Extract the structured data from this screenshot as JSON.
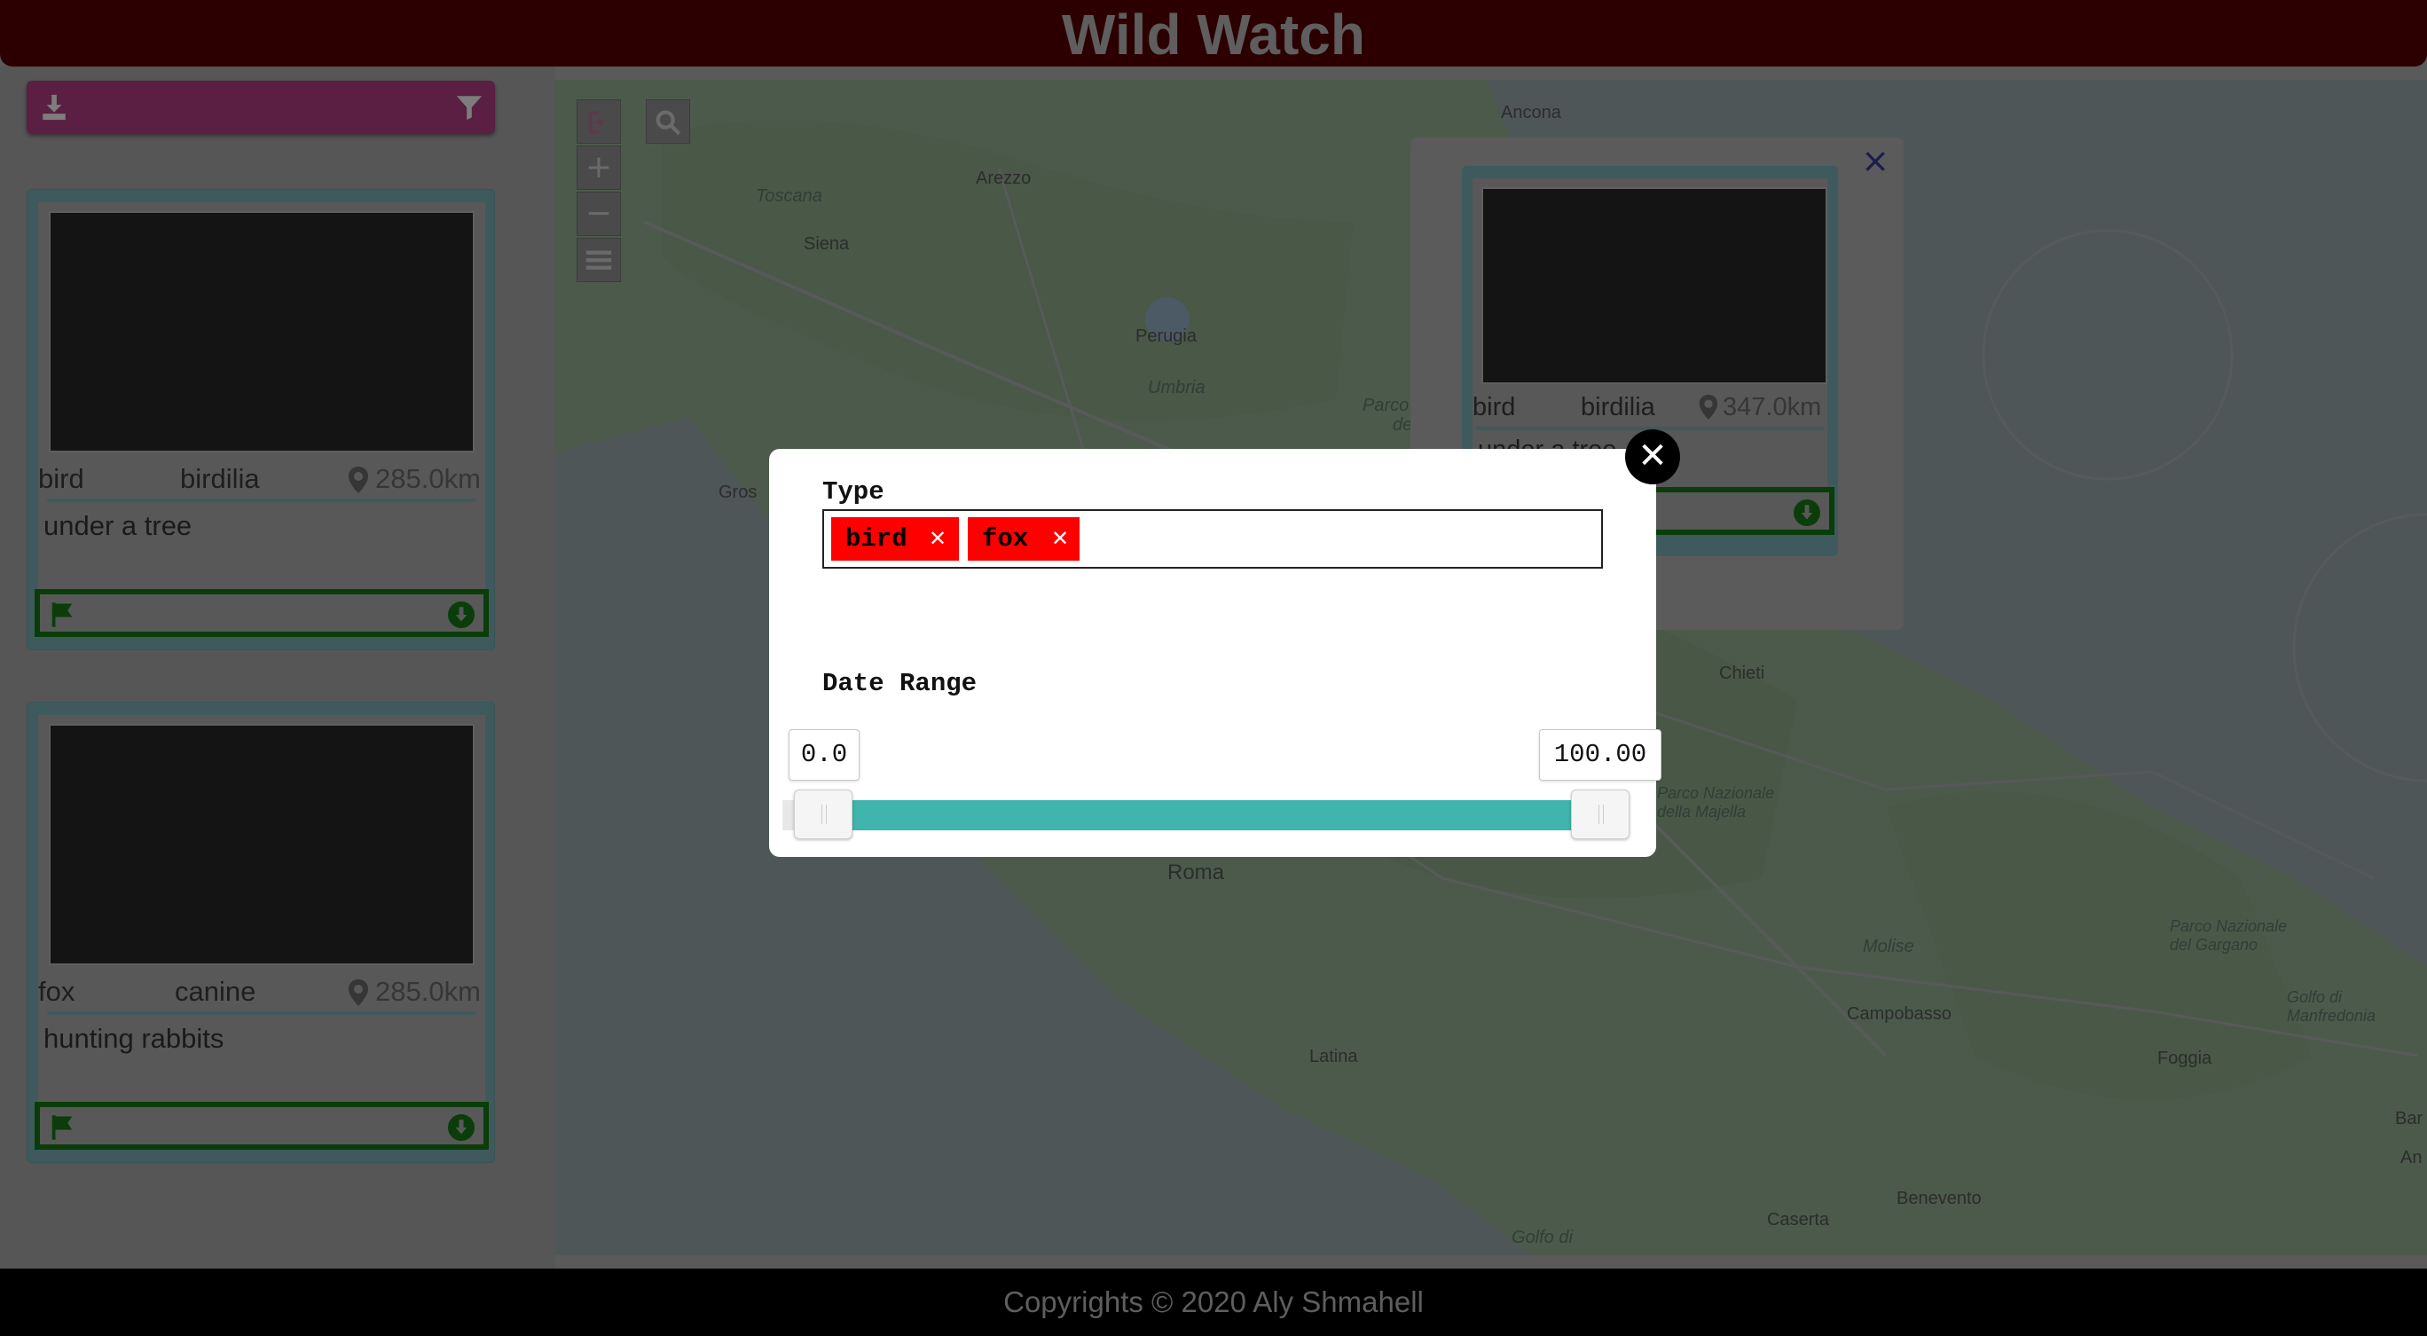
{
  "app": {
    "title": "Wild Watch"
  },
  "toolbar": {
    "download_icon": "download-icon",
    "filter_icon": "filter-icon"
  },
  "cards": [
    {
      "type": "bird",
      "family": "birdilia",
      "distance": "285.0km",
      "description": "under a tree"
    },
    {
      "type": "fox",
      "family": "canine",
      "distance": "285.0km",
      "description": "hunting rabbits"
    }
  ],
  "map": {
    "zoom_in": "+",
    "zoom_out": "−",
    "labels": {
      "ancona": "Ancona",
      "toscana": "Toscana",
      "arezzo": "Arezzo",
      "siena": "Siena",
      "perugia": "Perugia",
      "umbria": "Umbria",
      "grosseto": "Gros",
      "roma": "Roma",
      "chieti": "Chieti",
      "majella": "Parco Nazionale della Majella",
      "molise": "Molise",
      "campobasso": "Campobasso",
      "latina": "Latina",
      "foggia": "Foggia",
      "gargano": "Parco Nazionale del Gargano",
      "manfredonia": "Golfo di Manfredonia",
      "benevento": "Benevento",
      "caserta": "Caserta",
      "golfo": "Golfo di",
      "parco": "Parco",
      "de": "de",
      "bar": "Bar",
      "an": "An"
    },
    "popup": {
      "type": "bird",
      "family": "birdilia",
      "distance": "347.0km",
      "description": "under a tree"
    }
  },
  "filter_modal": {
    "type_label": "Type",
    "tags": [
      "bird",
      "fox"
    ],
    "date_range_label": "Date Range",
    "range_min": "0.0",
    "range_max": "100.00",
    "range_low_fraction": 0.0,
    "range_high_fraction": 1.0
  },
  "footer": {
    "text": "Copyrights © 2020 Aly Shmahell"
  },
  "colors": {
    "accent_teal": "#40b5ad",
    "tag_red": "#ff0000",
    "header": "#2c0000",
    "toolbar": "#5a1f42",
    "action_green": "#0a3d0a"
  }
}
